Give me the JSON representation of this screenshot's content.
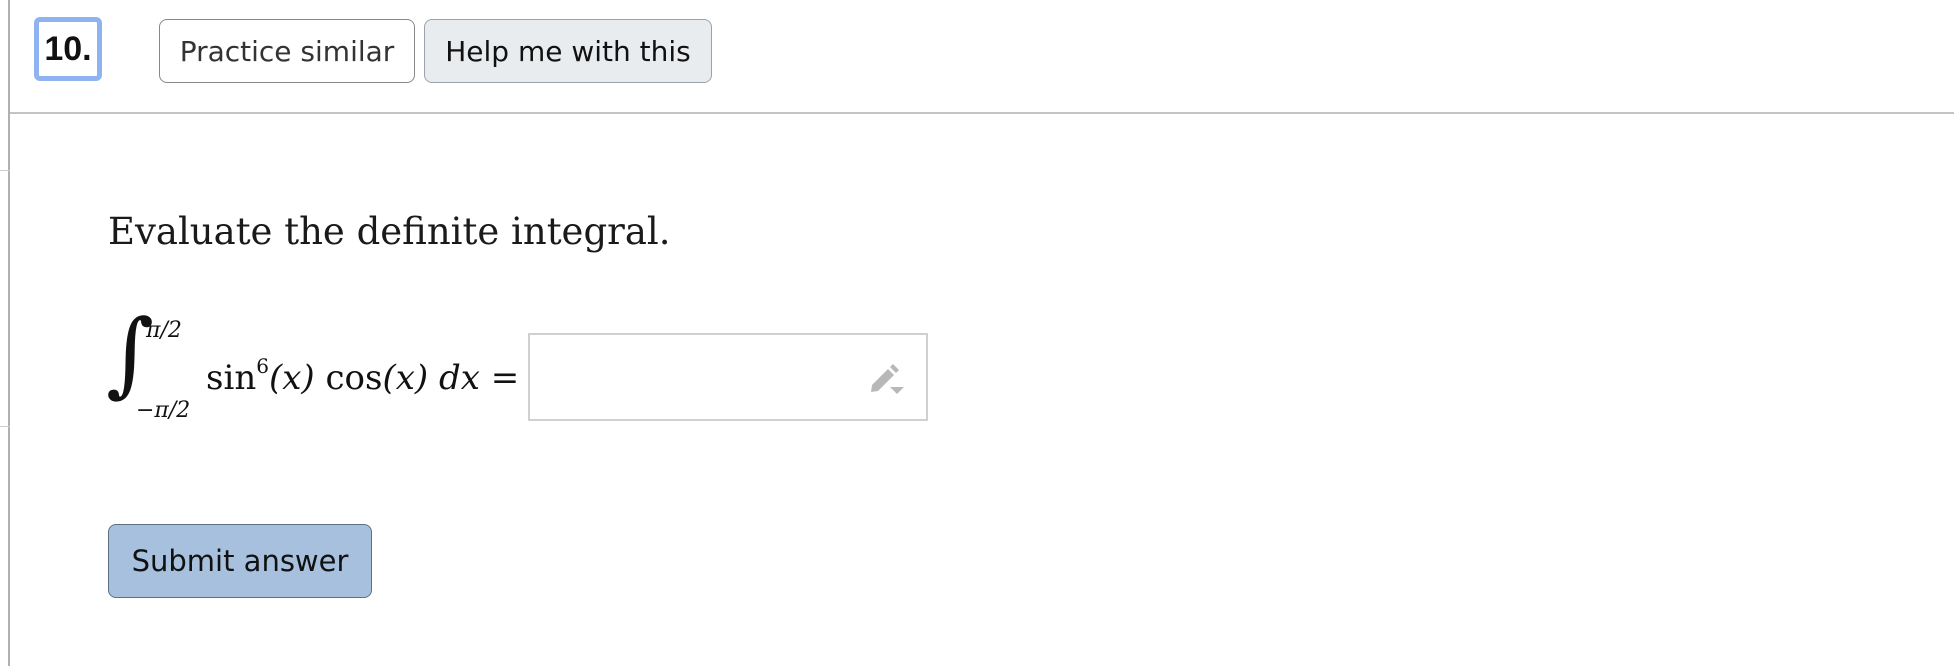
{
  "header": {
    "question_number": "10.",
    "practice_label": "Practice similar",
    "help_label": "Help me with this"
  },
  "question": {
    "prompt": "Evaluate the definite integral.",
    "upper_limit": "π/2",
    "lower_limit": "−π/2",
    "integrand_fn1": "sin",
    "integrand_exp": "6",
    "integrand_arg1": "(x)",
    "integrand_fn2": "cos",
    "integrand_arg2": "(x)",
    "differential": "dx",
    "equals": "="
  },
  "answer": {
    "value": "",
    "tool_icon": "pencil-icon"
  },
  "submit_label": "Submit answer"
}
